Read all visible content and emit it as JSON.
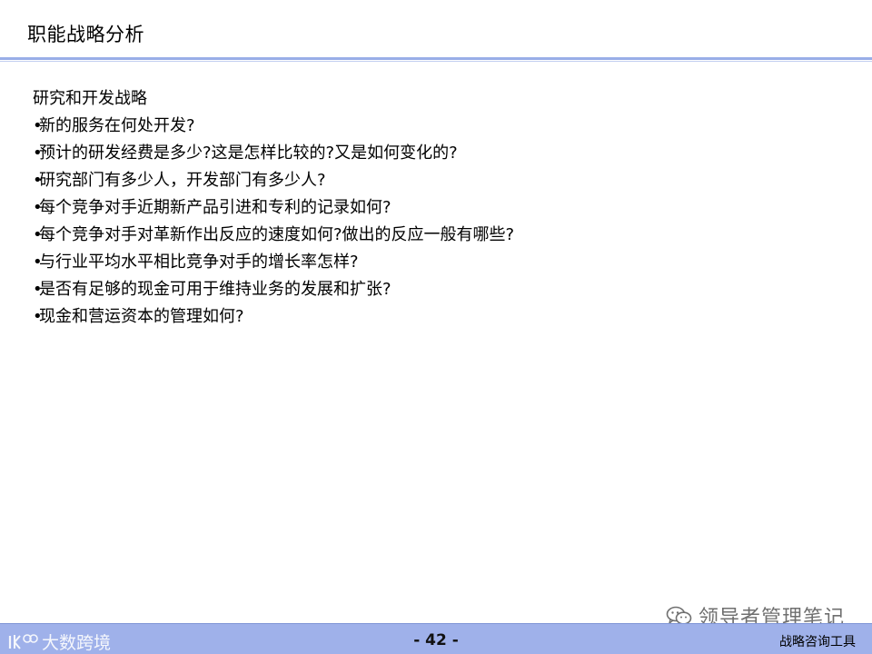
{
  "slide": {
    "title": "职能战略分析",
    "heading": "研究和开发战略",
    "bullet_marker": "•",
    "bullets": [
      "新的服务在何处开发?",
      "预计的研发经费是多少?这是怎样比较的?又是如何变化的?",
      "研究部门有多少人，开发部门有多少人?",
      "每个竞争对手近期新产品引进和专利的记录如何?",
      "每个竞争对手对革新作出反应的速度如何?做出的反应一般有哪些?",
      "与行业平均水平相比竞争对手的增长率怎样?",
      "是否有足够的现金可用于维持业务的发展和扩张?",
      "现金和营运资本的管理如何?"
    ]
  },
  "watermark": {
    "icon": "wechat-icon",
    "text": "领导者管理笔记"
  },
  "footer": {
    "logo_text": "大数跨境",
    "logo_icon": "brand-logo-icon",
    "page_number": "- 42 -",
    "label": "战略咨询工具"
  },
  "colors": {
    "accent_rule": "#99aee8",
    "footer_bar": "#9fb1ea",
    "text": "#000000"
  }
}
